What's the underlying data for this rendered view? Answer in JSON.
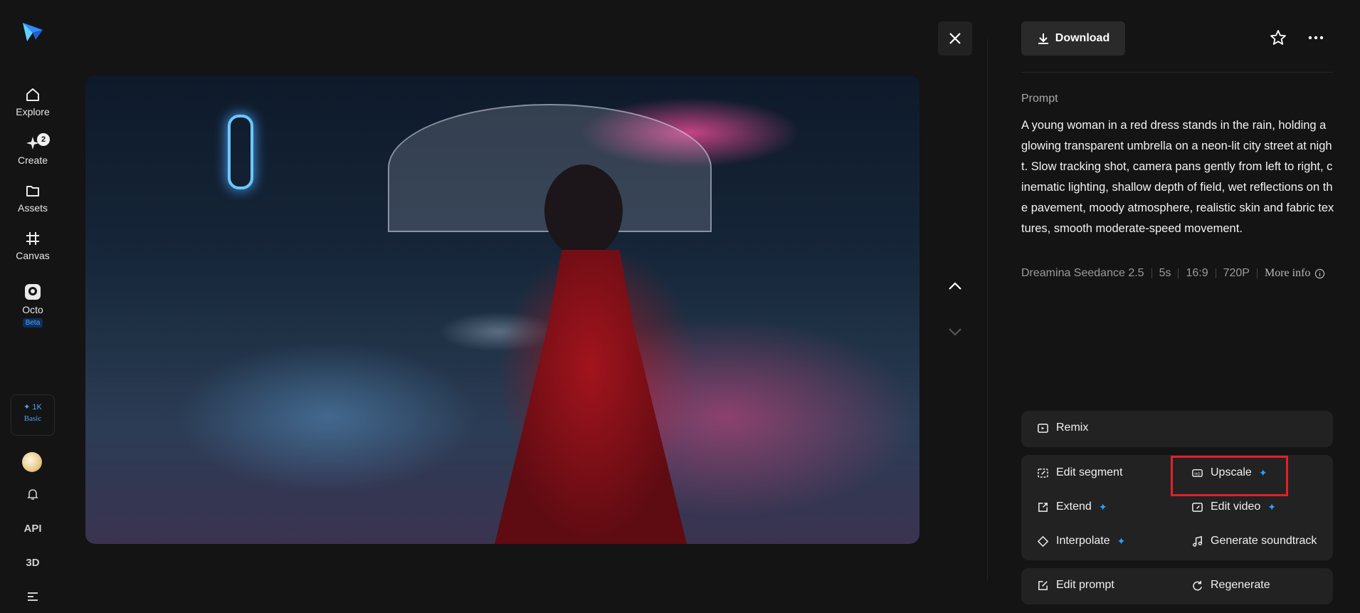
{
  "sidebar": {
    "items": [
      {
        "label": "Explore",
        "icon": "home-icon"
      },
      {
        "label": "Create",
        "icon": "sparkle-create-icon",
        "badge": "2"
      },
      {
        "label": "Assets",
        "icon": "folder-icon"
      },
      {
        "label": "Canvas",
        "icon": "canvas-icon"
      },
      {
        "label": "Octo",
        "icon": "octo-icon",
        "tag": "Beta"
      }
    ],
    "credits": {
      "amount": "✦ 1K",
      "plan": "Basic"
    },
    "api_label": "API",
    "threed_label": "3D"
  },
  "toolbar": {
    "download_label": "Download"
  },
  "prompt": {
    "title": "Prompt",
    "text": "A young woman in a red dress stands in the rain, holding a glowing transparent umbrella on a neon-lit city street at night. Slow tracking shot, camera pans gently from left to right, cinematic lighting, shallow depth of field, wet reflections on the pavement, moody atmosphere, realistic skin and fabric textures, smooth moderate-speed movement."
  },
  "meta": {
    "model": "Dreamina Seedance 2.5",
    "duration": "5s",
    "ratio": "16:9",
    "resolution": "720P",
    "more_info": "More info"
  },
  "actions": {
    "remix": "Remix",
    "edit_segment": "Edit segment",
    "upscale": "Upscale",
    "extend": "Extend",
    "edit_video": "Edit video",
    "interpolate": "Interpolate",
    "generate_soundtrack": "Generate soundtrack",
    "edit_prompt": "Edit prompt",
    "regenerate": "Regenerate"
  },
  "colors": {
    "accent": "#2aa0ff",
    "highlight": "#e0212b",
    "background": "#141414",
    "card": "#222222"
  }
}
